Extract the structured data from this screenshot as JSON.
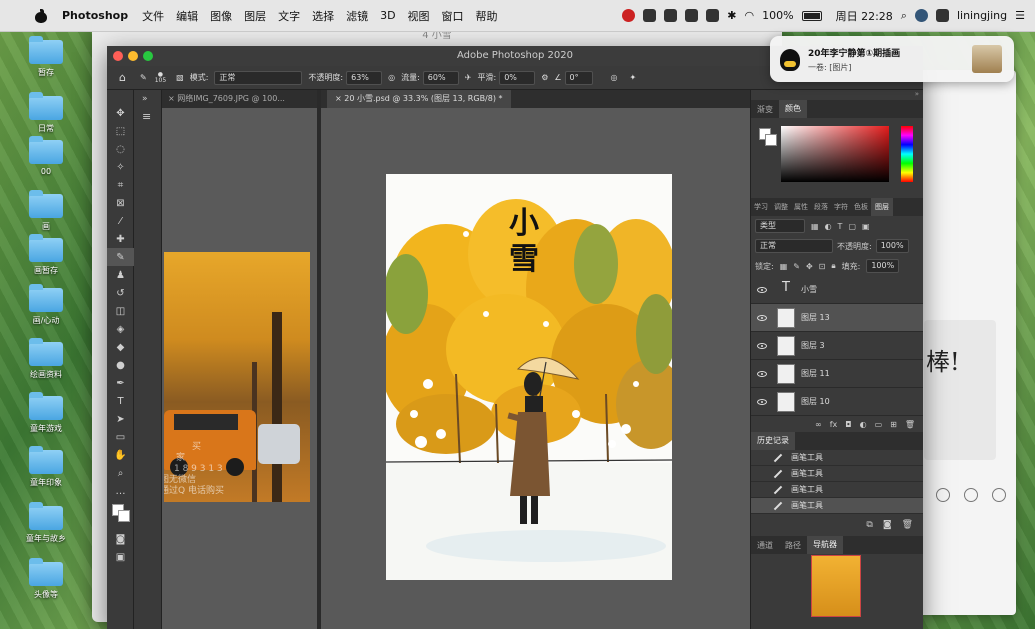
{
  "menubar": {
    "app": "Photoshop",
    "menus": [
      "文件",
      "编辑",
      "图像",
      "图层",
      "文字",
      "选择",
      "滤镜",
      "3D",
      "视图",
      "窗口",
      "帮助"
    ],
    "battery": "100%",
    "clock": "周日 22:28",
    "user": "liningjing"
  },
  "desktop": {
    "icons": [
      "暂存",
      "日常",
      "00",
      "画",
      "画暂存",
      "画/心动",
      "绘画资料",
      "童年游戏",
      "童年印象",
      "童年与故乡",
      "头像等"
    ]
  },
  "bg_window": {
    "title": "4 小雪"
  },
  "notification": {
    "title": "20年李宁静第①期插画",
    "body": "一卷: [图片]"
  },
  "photoshop": {
    "title": "Adobe Photoshop 2020",
    "options": {
      "brush_size": "105",
      "mode_label": "模式:",
      "mode_value": "正常",
      "opacity_label": "不透明度:",
      "opacity_value": "63%",
      "flow_label": "流量:",
      "flow_value": "60%",
      "smooth_label": "平滑:",
      "smooth_value": "0%",
      "angle_value": "0°"
    },
    "doc1_tab": "网络IMG_7609.JPG @ 100...",
    "doc2_tab": "20 小雪.psd @ 33.3% (图层 13, RGB/8) *",
    "artwork_title": "小雪",
    "photo_overlay": [
      "买",
      "家",
      "1 8 9 3 1 3",
      "图无微信",
      "通过Q    电话购买"
    ],
    "color_tabs": [
      "渐变",
      "颜色"
    ],
    "layer_tabs": [
      "学习",
      "调整",
      "属性",
      "段落",
      "字符",
      "色板",
      "图层"
    ],
    "layer_filter": "类型",
    "blend_mode": "正常",
    "layer_opacity_label": "不透明度:",
    "layer_opacity": "100%",
    "lock_label": "锁定:",
    "fill_label": "填充:",
    "fill_value": "100%",
    "layers": [
      {
        "name": "小雪",
        "kind": "text"
      },
      {
        "name": "图层 13",
        "kind": "pixel"
      },
      {
        "name": "图层 3",
        "kind": "pixel"
      },
      {
        "name": "图层 11",
        "kind": "pixel"
      },
      {
        "name": "图层 10",
        "kind": "pixel"
      }
    ],
    "history_title": "历史记录",
    "history": [
      "画笔工具",
      "画笔工具",
      "画笔工具",
      "画笔工具"
    ],
    "nav_tabs": [
      "通道",
      "路径",
      "导航器"
    ]
  }
}
